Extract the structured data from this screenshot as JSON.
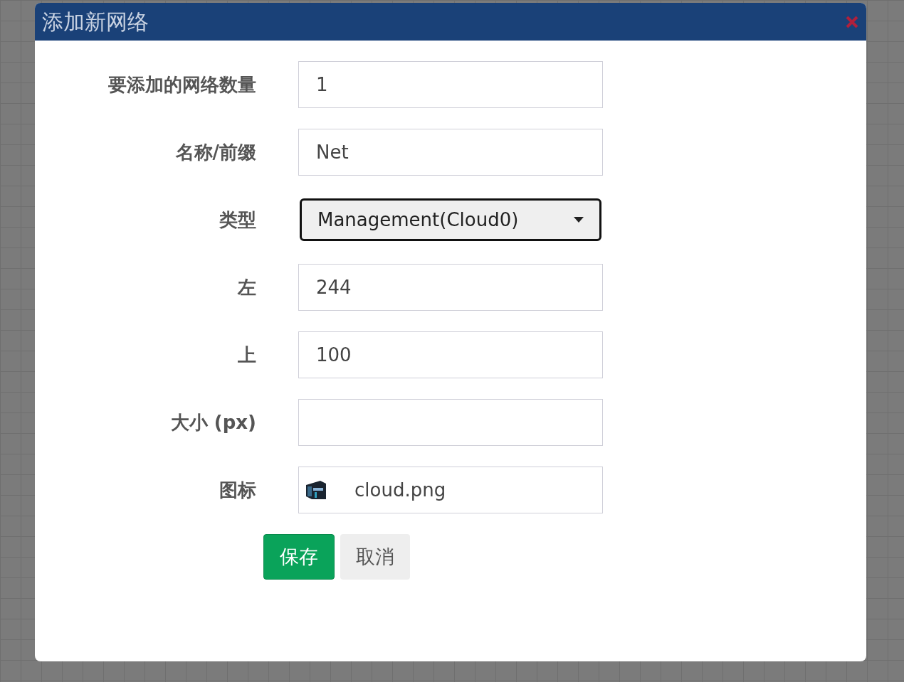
{
  "dialog": {
    "title": "添加新网络"
  },
  "fields": [
    {
      "kind": "text",
      "label": "要添加的网络数量",
      "value": "1"
    },
    {
      "kind": "text",
      "label": "名称/前缀",
      "value": "Net"
    },
    {
      "kind": "select",
      "label": "类型",
      "value": "Management(Cloud0)",
      "focused": true
    },
    {
      "kind": "text",
      "label": "左",
      "value": "244"
    },
    {
      "kind": "text",
      "label": "上",
      "value": "100"
    },
    {
      "kind": "text",
      "label": "大小 (px)"
    },
    {
      "kind": "icon",
      "label": "图标",
      "value": "cloud.png"
    }
  ],
  "buttons": [
    {
      "kind": "primary",
      "label": "保存"
    },
    {
      "kind": "secondary",
      "label": "取消"
    }
  ]
}
